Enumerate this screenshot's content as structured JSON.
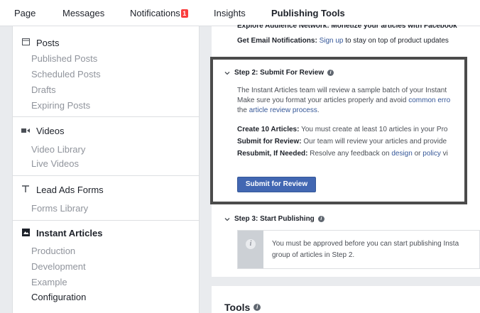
{
  "topnav": {
    "tabs": [
      {
        "label": "Page"
      },
      {
        "label": "Messages"
      },
      {
        "label": "Notifications",
        "badge": "1"
      },
      {
        "label": "Insights"
      },
      {
        "label": "Publishing Tools",
        "active": true
      }
    ]
  },
  "sidebar": {
    "posts": {
      "title": "Posts",
      "items": [
        "Published Posts",
        "Scheduled Posts",
        "Drafts",
        "Expiring Posts"
      ]
    },
    "videos": {
      "title": "Videos",
      "items": [
        "Video Library",
        "Live Videos"
      ]
    },
    "lead_ads": {
      "title": "Lead Ads Forms",
      "items": [
        "Forms Library"
      ]
    },
    "instant_articles": {
      "title": "Instant Articles",
      "items": [
        "Production",
        "Development",
        "Example",
        "Configuration"
      ],
      "current": "Configuration"
    }
  },
  "main": {
    "top_partial_text": "Explore Audience Network: Monetize your articles with Facebook",
    "email_notifications": {
      "label": "Get Email Notifications:",
      "link": "Sign up",
      "rest": "to stay on top of product updates"
    },
    "step2": {
      "title": "Step 2: Submit For Review",
      "para_line1": "The Instant Articles team will review a sample batch of your Instant",
      "para_line2_pre": "Make sure you format your articles properly and avoid",
      "para_line2_link": "common erro",
      "para_line3_pre": "the",
      "para_line3_link": "article review process",
      "para_line3_post": ".",
      "create_label": "Create 10 Articles:",
      "create_text": "You must create at least 10 articles in your Pro",
      "submit_label": "Submit for Review:",
      "submit_text": "Our team will review your articles and provide",
      "resubmit_label": "Resubmit, If Needed:",
      "resubmit_text": "Resolve any feedback on",
      "resubmit_link1": "design",
      "resubmit_or": "or",
      "resubmit_link2": "policy",
      "resubmit_tail": "vi",
      "button": "Submit for Review"
    },
    "step3": {
      "title": "Step 3: Start Publishing",
      "notice_line1": "You must be approved before you can start publishing Insta",
      "notice_line2": "group of articles in Step 2."
    },
    "tools": {
      "title": "Tools"
    }
  },
  "colors": {
    "link": "#365899",
    "button": "#4267b2",
    "badge": "#fa3e3e",
    "highlight_border": "#4b4b4b"
  }
}
